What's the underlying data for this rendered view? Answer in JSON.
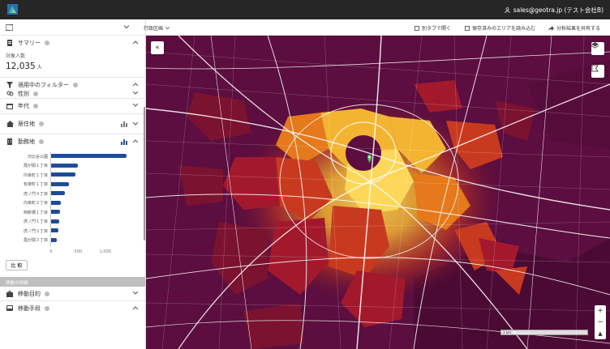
{
  "header": {
    "user_label": "sales@geotra.jp (テスト会社B)"
  },
  "toolbar": {
    "area_dropdown": "行政区画",
    "open_new_tab": "別タブで開く",
    "load_saved_area": "保存済みのエリアを読み込む",
    "share_results": "分析結果を共有する"
  },
  "sidebar": {
    "summary": {
      "title": "サマリー",
      "count_label": "対象人数",
      "count_value": "12,035",
      "count_unit": "人"
    },
    "filters_title": "適用中のフィルター",
    "gender_title": "性別",
    "age_title": "年代",
    "residence_title": "居住地",
    "workplace_title": "勤務地",
    "compare_button": "比 較",
    "movement_band": "移動の詳細",
    "purpose_title": "移動目的",
    "method_title": "移動手段"
  },
  "chart_data": {
    "type": "bar",
    "orientation": "horizontal",
    "categories": [
      "日比谷公園",
      "霞が関１丁目",
      "内幸町１丁目",
      "有楽町１丁目",
      "虎ノ門４丁目",
      "内幸町２丁目",
      "西新橋１丁目",
      "虎ノ門１丁目",
      "虎ノ門２丁目",
      "霞が関３丁目"
    ],
    "values": [
      1400,
      500,
      450,
      330,
      250,
      180,
      170,
      150,
      130,
      110
    ],
    "xticks": [
      "0",
      "500",
      "1,000"
    ],
    "xlim": [
      0,
      1500
    ],
    "color": "#1e4b9b"
  },
  "map": {
    "collapse_icon": "«",
    "layers_icon": "layers-icon",
    "draw_icon": "draw-area-icon",
    "zoom_in": "+",
    "zoom_out": "−",
    "compass": "▲",
    "scale_text": "1 km",
    "base_color": "#5b0e3f",
    "heat_colors": [
      "#7a1230",
      "#a3192c",
      "#c83a1f",
      "#e5791b",
      "#f3b431",
      "#fcd75a"
    ]
  }
}
